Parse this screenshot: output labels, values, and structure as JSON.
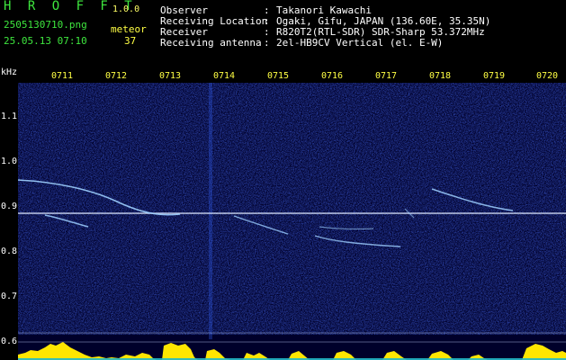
{
  "header": {
    "app_title": "H R O F F T",
    "version": "1.0.0",
    "filename": "2505130710.png",
    "datetime": "25.05.13 07:10",
    "meteor_label": "meteor",
    "meteor_count": "37",
    "rows": [
      {
        "label": "Observer",
        "sep": ":",
        "value": "Takanori Kawachi"
      },
      {
        "label": "Receiving Location",
        "sep": ":",
        "value": "Ogaki, Gifu, JAPAN (136.60E, 35.35N)"
      },
      {
        "label": "Receiver",
        "sep": ":",
        "value": "R820T2(RTL-SDR) SDR-Sharp 53.372MHz"
      },
      {
        "label": "Receiving antenna",
        "sep": ":",
        "value": "2el-HB9CV Vertical (el. E-W)"
      }
    ]
  },
  "axis": {
    "unit": "kHz",
    "y_ticks": [
      "1.1",
      "1.0",
      "0.9",
      "0.8",
      "0.7",
      "0.6"
    ],
    "x_ticks": [
      "0711",
      "0712",
      "0713",
      "0714",
      "0715",
      "0716",
      "0717",
      "0718",
      "0719",
      "0720"
    ]
  },
  "colors": {
    "background": "#00002a",
    "noise": "#1a2ab0",
    "carrier": "#dde8ff",
    "trail": "#9fd0ff",
    "bottom_bars": "#ffe600"
  }
}
